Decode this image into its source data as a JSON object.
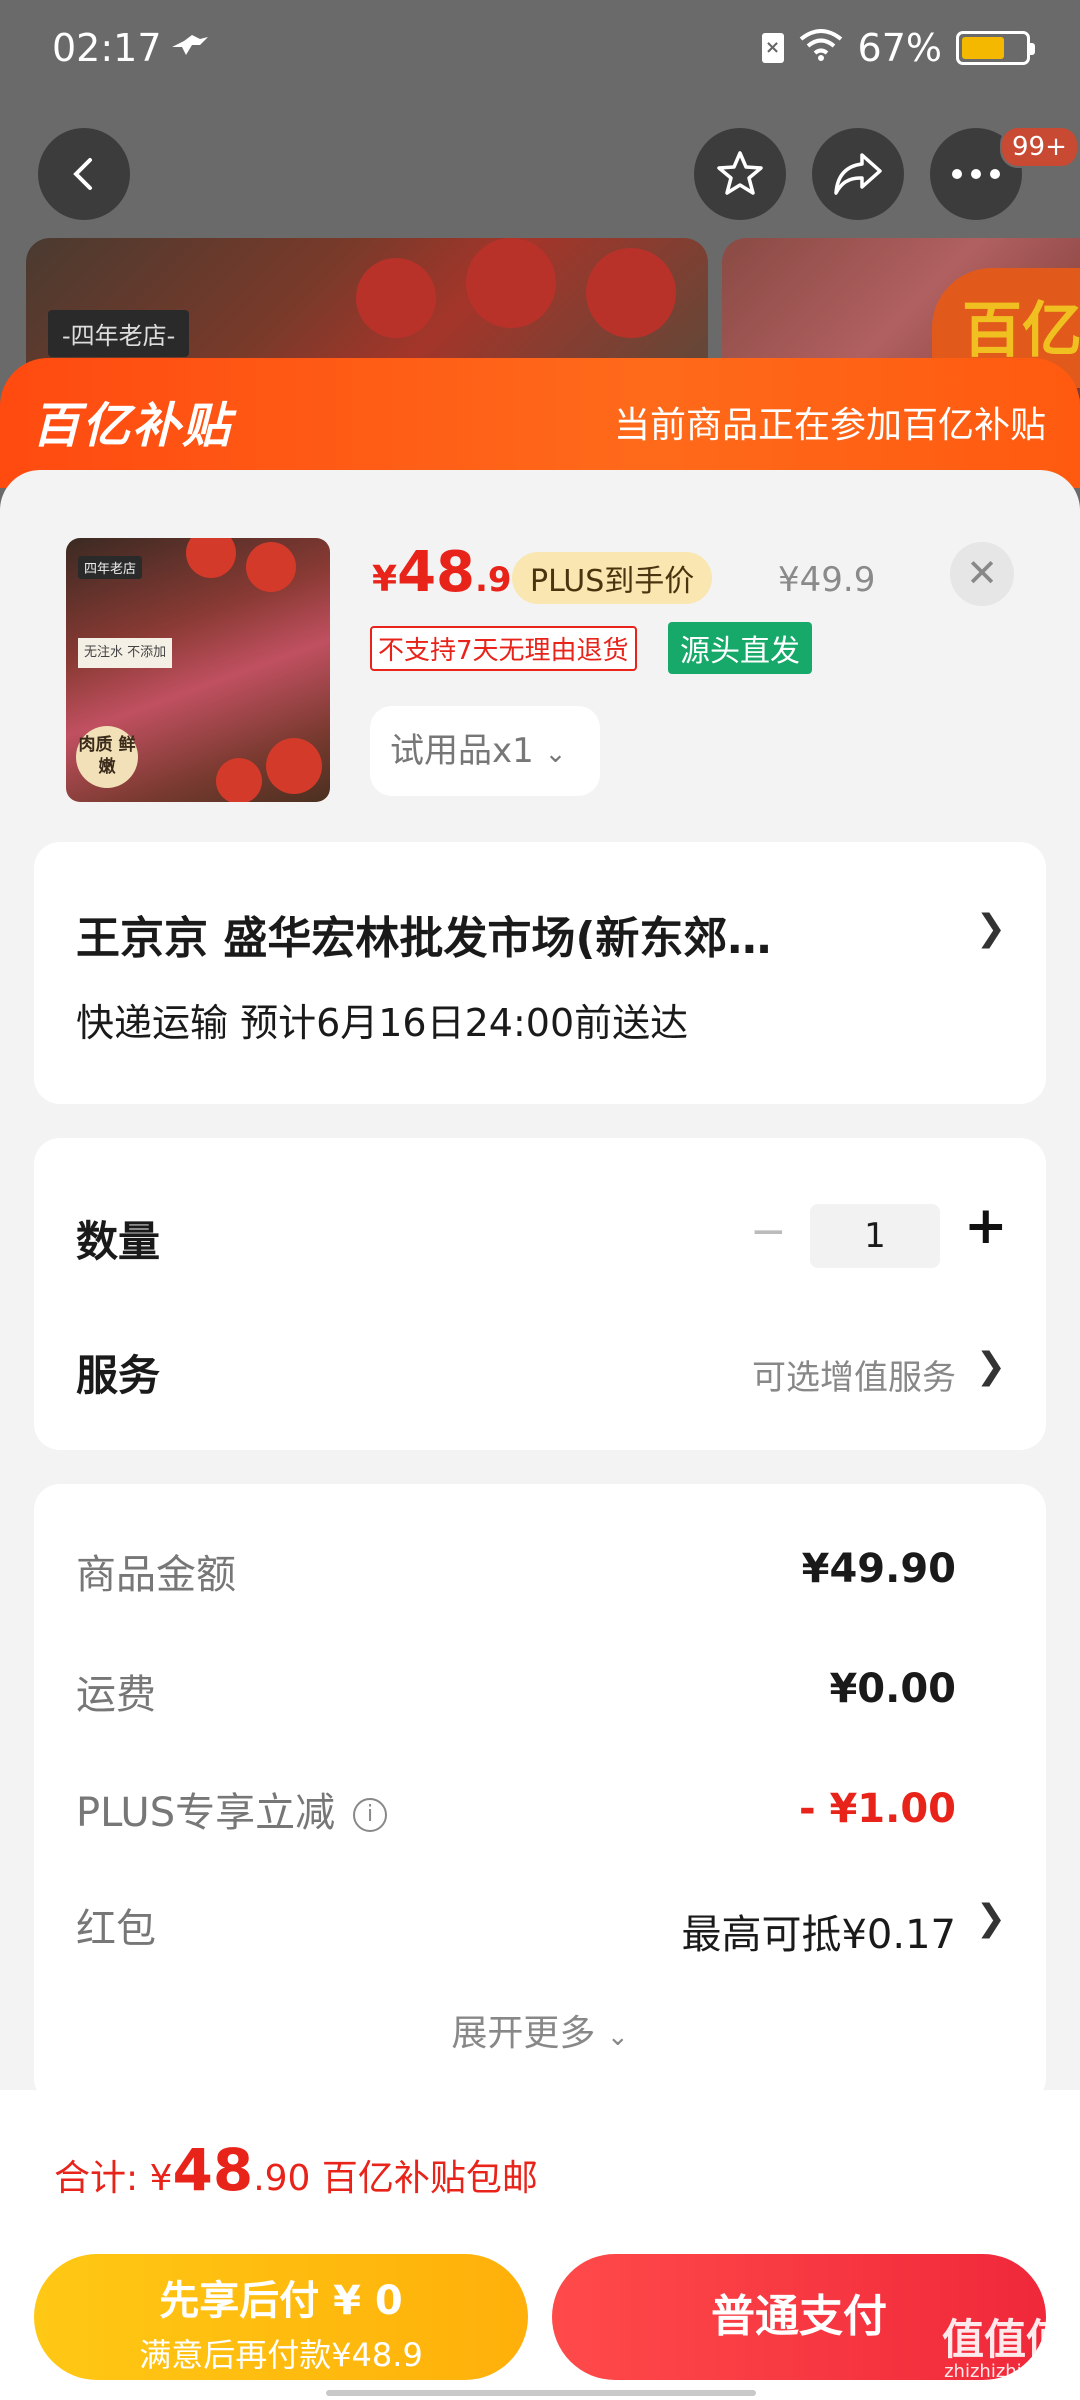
{
  "status_bar": {
    "time": "02:17",
    "battery": "67%",
    "battery_level": 0.67
  },
  "top_nav": {
    "badge": "99+"
  },
  "background": {
    "store_tag": "-四年老店-",
    "logo_fragment": "百亿"
  },
  "sheet_header": {
    "brand": "百亿补贴",
    "note": "当前商品正在参加百亿补贴"
  },
  "product": {
    "price_currency": "¥",
    "price_int": "48",
    "price_dec": ".9",
    "plus_tag": "PLUS到手价",
    "original_price": "¥49.9",
    "tag_noreturn": "不支持7天无理由退货",
    "tag_source": "源头直发",
    "spec": "试用品x1",
    "thumb_badge": "肉质 鲜嫩",
    "thumb_tag": "四年老店",
    "thumb_side": "无注水 不添加"
  },
  "address": {
    "line1": "王京京  盛华宏林批发市场(新东郊…",
    "line2": "快递运输 预计6月16日24:00前送达"
  },
  "quantity": {
    "label": "数量",
    "value": "1",
    "minus": "−",
    "plus": "+"
  },
  "service": {
    "label": "服务",
    "hint": "可选增值服务"
  },
  "summary": {
    "rows": [
      {
        "label": "商品金额",
        "value": "¥49.90"
      },
      {
        "label": "运费",
        "value": "¥0.00"
      },
      {
        "label": "PLUS专享立减",
        "value": "- ¥1.00"
      },
      {
        "label": "红包",
        "value": "最高可抵¥0.17"
      }
    ],
    "expand": "展开更多"
  },
  "bottom": {
    "total_prefix": "合计: ¥",
    "total_int": "48",
    "total_dec": ".90",
    "total_suffix": " 百亿补贴包邮",
    "paylater_l1": "先享后付 ¥ 0",
    "paylater_l2": "满意后再付款¥48.9",
    "pay": "普通支付"
  },
  "watermark": {
    "text": "值值值",
    "sub": "zhizhizhi.com"
  }
}
